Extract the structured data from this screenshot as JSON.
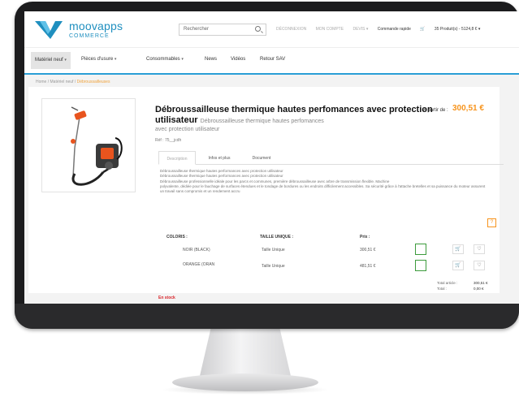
{
  "brand": {
    "name": "moovapps",
    "sub": "COMMERCE",
    "accent": "#1f8fbf",
    "logo_icon": "moovapps-logo-icon"
  },
  "header": {
    "search_placeholder": "Rechercher",
    "links": [
      "DÉCONNEXION",
      "MON COMPTE",
      "DEVIS ▾"
    ],
    "quick_order": "Commande rapide",
    "cart": "35 Produit(s) - 5124,8 € ▾"
  },
  "nav": {
    "items": [
      {
        "label": "Matériel neuf",
        "has_caret": true,
        "active": true
      },
      {
        "label": "Pièces d'usure",
        "has_caret": true,
        "active": false
      },
      {
        "label": "Consommables",
        "has_caret": true,
        "active": false
      },
      {
        "label": "News",
        "has_caret": false,
        "active": false
      },
      {
        "label": "Vidéos",
        "has_caret": false,
        "active": false
      },
      {
        "label": "Retour SAV",
        "has_caret": false,
        "active": false
      }
    ]
  },
  "breadcrumb": {
    "home": "Home",
    "sep": "/",
    "parent": "Matériel neuf",
    "current": "Débroussailleuses"
  },
  "product": {
    "title_main": "Débroussailleuse thermique hautes perfomances avec protection utilisateur",
    "title_sub": "Débroussailleuse thermique hautes perfomances",
    "title_sub2": "avec protection utilisateur",
    "price_label": "A partir de :",
    "price": "300,51 €",
    "ref": "Réf : 75__jcdh",
    "tabs": [
      "Description",
      "Infos et plus",
      "Document"
    ],
    "description": [
      "Débroussailleuse thermique hautes performances avec protection utilisateur",
      "Débroussailleuse thermique hautes performances avec protection utilisateur",
      "Débroussailleuse professionnelle idéale pour les parcs et communes, première débroussailleuse avec arbre de transmission flexible. Machine",
      "polyvalente, dédiée pour le fauchage de surfaces étendues et le tondage de bordures ou les endroits difficilement accessibles. Sa sécurité grâce à l'attache bretelles et sa puissance du moteur assurent",
      "un travail sans compromis et un rendement accru"
    ],
    "help": "?"
  },
  "table": {
    "headers": [
      "COLORIS :",
      "TAILLE UNIQUE :",
      "Prix :"
    ],
    "rows": [
      {
        "color": "NOIR (BLACK)",
        "size": "Taille Unique",
        "price": "300,51 €"
      },
      {
        "color": "ORANGE (ORAN",
        "size": "Taille Unique",
        "price": "481,51 €"
      }
    ],
    "cart_icon": "cart-icon",
    "wish_icon": "heart-icon",
    "totals": [
      {
        "label": "Total article :",
        "value": "300,51 €"
      },
      {
        "label": "Total :",
        "value": "0,00 €"
      }
    ]
  },
  "stock": "En stock"
}
